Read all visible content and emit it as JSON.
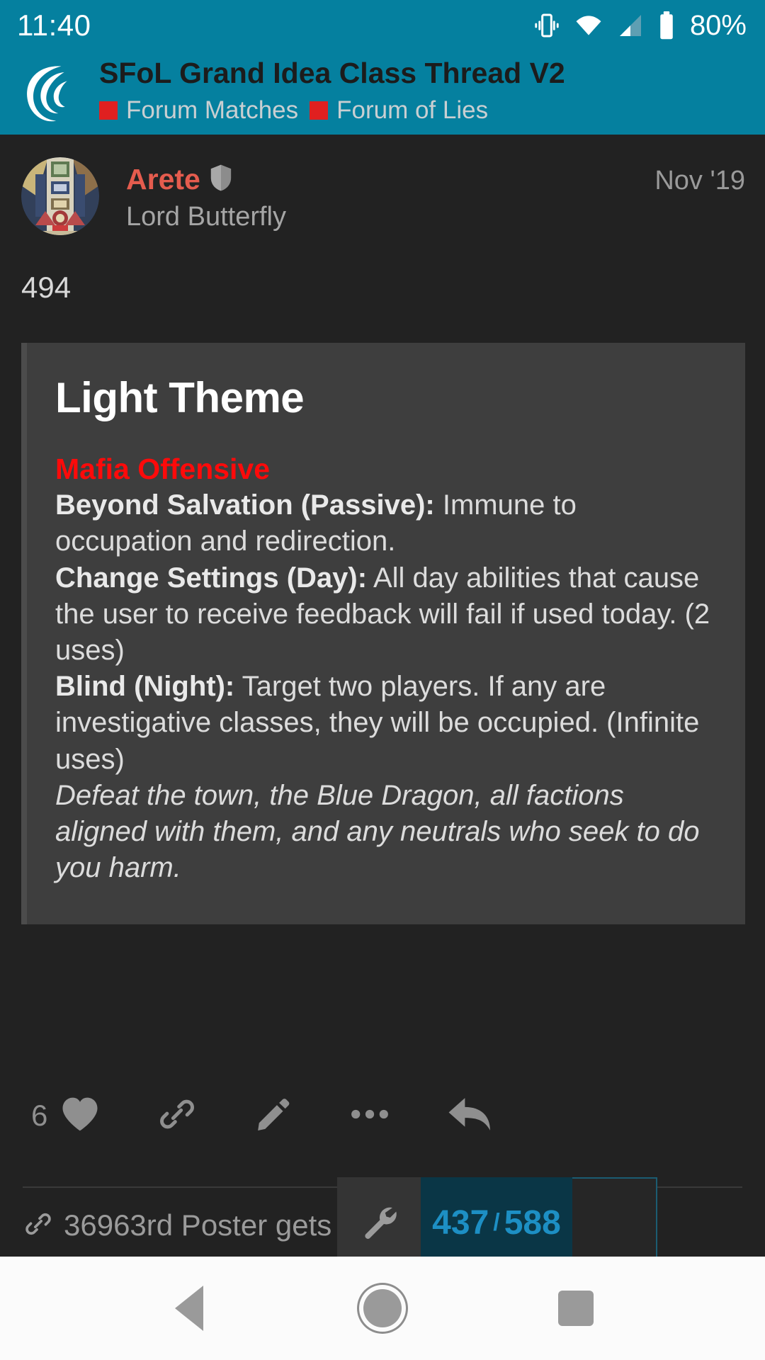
{
  "status_bar": {
    "time": "11:40",
    "battery_percent": "80%",
    "icons": [
      "vibrate-icon",
      "wifi-icon",
      "cell-signal-icon",
      "battery-icon"
    ]
  },
  "app_header": {
    "logo": "forum-swirl-logo",
    "thread_title": "SFoL Grand Idea Class Thread V2",
    "breadcrumbs": [
      {
        "label": "Forum Matches",
        "color": "#e02020"
      },
      {
        "label": "Forum of Lies",
        "color": "#e02020"
      }
    ]
  },
  "post": {
    "avatar": "mosaic-ceiling-avatar",
    "username": "Arete",
    "badge_icon": "shield-icon",
    "title": "Lord Butterfly",
    "date": "Nov '19",
    "post_number": "494",
    "quote": {
      "heading": "Light Theme",
      "faction": "Mafia Offensive",
      "abilities": [
        {
          "name": "Beyond Salvation (Passive):",
          "text": " Immune to occupation and redirection."
        },
        {
          "name": "Change Settings (Day):",
          "text": " All day abilities that cause the user to receive feedback will fail if used today. (2 uses)"
        },
        {
          "name": "Blind (Night):",
          "text": " Target two players. If any are investigative classes, they will be occupied. (Infinite uses)"
        }
      ],
      "goal": "Defeat the town, the Blue Dragon, all factions aligned with them, and any neutrals who seek to do you harm."
    }
  },
  "actions": {
    "like_count": "6",
    "like_icon": "heart-icon",
    "link_icon": "link-icon",
    "edit_icon": "pencil-icon",
    "more_icon": "ellipsis-icon",
    "reply_icon": "reply-arrow-icon"
  },
  "footer": {
    "suggested_icon": "link-icon",
    "suggested_label": "36963rd Poster gets"
  },
  "progress": {
    "tool_icon": "wrench-icon",
    "current": "437",
    "separator": "/",
    "total": "588"
  },
  "nav_bar": {
    "back": "back-triangle-icon",
    "home": "home-circle-icon",
    "recents": "recents-square-icon"
  },
  "colors": {
    "header_teal": "#05809F",
    "page_background": "#222222",
    "quote_background": "#3E3E3E",
    "username_red": "#e55c4e",
    "faction_red": "#ff0a0a",
    "progress_blue": "#1d8fc4",
    "progress_bg": "#0a3646",
    "breadcrumb_square": "#e02020"
  }
}
